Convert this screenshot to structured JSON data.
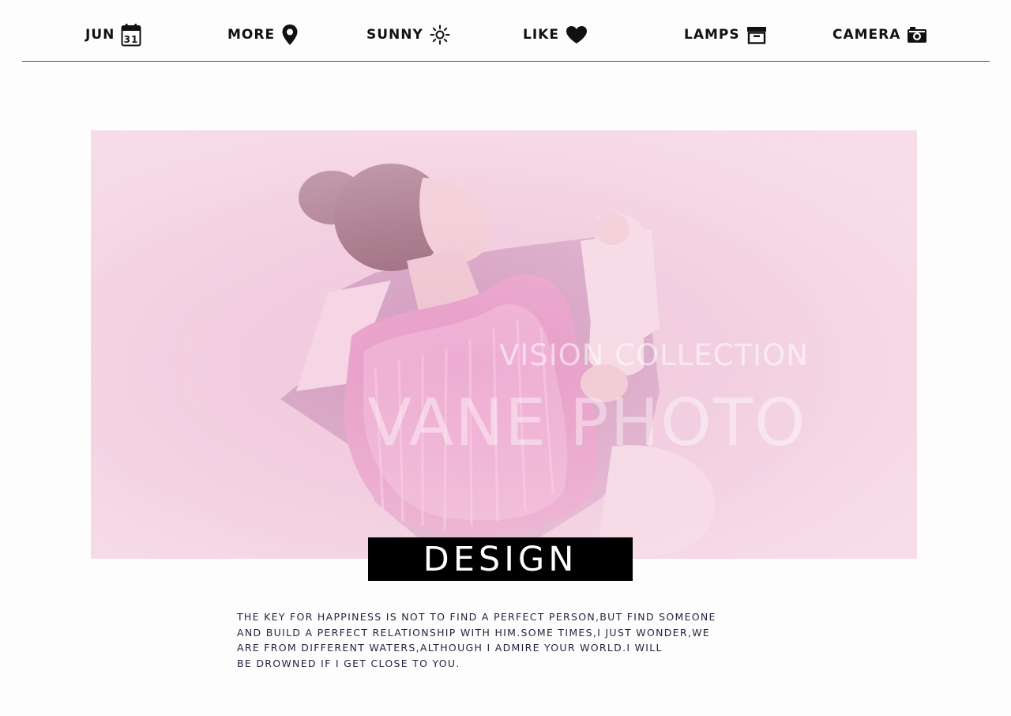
{
  "nav": {
    "items": [
      {
        "label": "JUN",
        "icon": "calendar-icon",
        "icon_text": "31"
      },
      {
        "label": "MORE",
        "icon": "map-pin-icon"
      },
      {
        "label": "SUNNY",
        "icon": "sun-icon"
      },
      {
        "label": "LIKE",
        "icon": "heart-icon"
      },
      {
        "label": "LAMPS",
        "icon": "archive-box-icon"
      },
      {
        "label": "CAMERA",
        "icon": "camera-icon"
      }
    ]
  },
  "hero": {
    "subtitle": "VISION COLLECTION",
    "title": "VANE PHOTO"
  },
  "banner": {
    "label": "DESIGN"
  },
  "body": {
    "lines": [
      "THE KEY FOR HAPPINESS IS NOT TO FIND A PERFECT PERSON,BUT FIND SOMEONE",
      "AND BUILD A PERFECT RELATIONSHIP WITH HIM.SOME TIMES,I JUST WONDER,WE",
      "ARE FROM DIFFERENT WATERS,ALTHOUGH I ADMIRE YOUR WORLD.I WILL",
      "BE DROWNED IF I GET CLOSE TO YOU."
    ]
  },
  "colors": {
    "background": "#fdfdfe",
    "hero_pink": "#efc9dc",
    "banner": "#000000",
    "body_text": "#2a1f3d"
  }
}
